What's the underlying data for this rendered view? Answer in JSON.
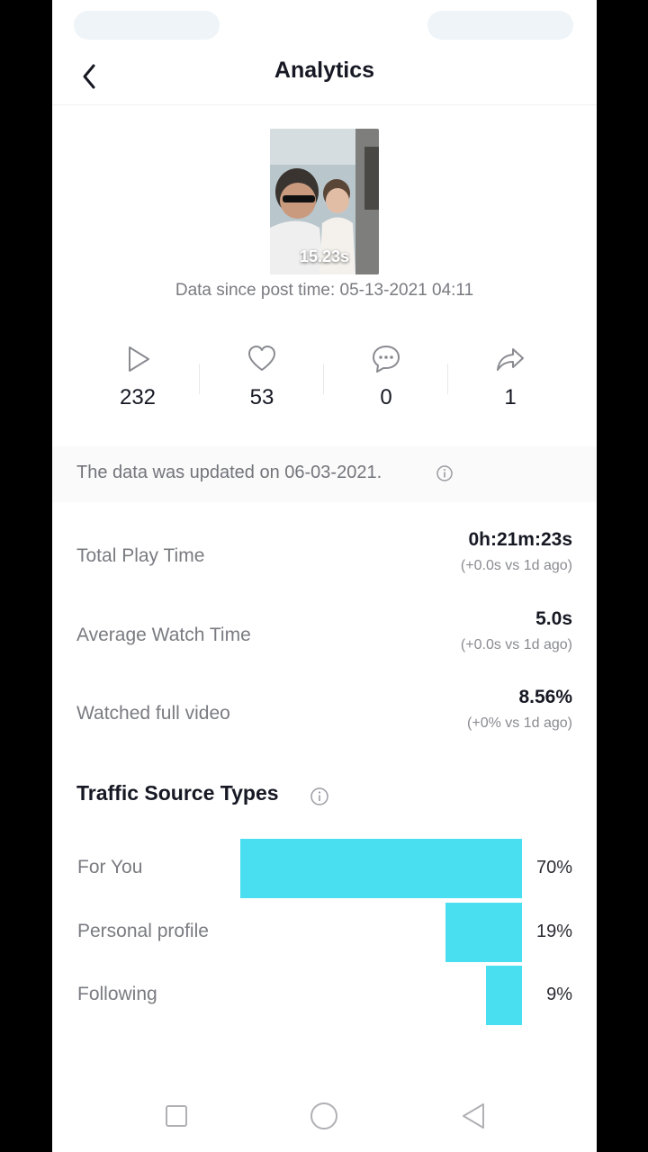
{
  "header": {
    "title": "Analytics"
  },
  "video": {
    "duration": "15.23s",
    "since_text": "Data since post time: 05-13-2021 04:11"
  },
  "stats": [
    {
      "icon": "play-icon",
      "value": "232"
    },
    {
      "icon": "heart-icon",
      "value": "53"
    },
    {
      "icon": "comment-icon",
      "value": "0"
    },
    {
      "icon": "share-icon",
      "value": "1"
    }
  ],
  "notice": {
    "text": "The data was updated on 06-03-2021."
  },
  "metrics": [
    {
      "label": "Total Play Time",
      "value": "0h:21m:23s",
      "delta": "(+0.0s vs 1d ago)"
    },
    {
      "label": "Average Watch Time",
      "value": "5.0s",
      "delta": "(+0.0s vs 1d ago)"
    },
    {
      "label": "Watched full video",
      "value": "8.56%",
      "delta": "(+0% vs 1d ago)"
    }
  ],
  "traffic": {
    "title": "Traffic Source Types",
    "bar_color": "#49dff1",
    "rows": [
      {
        "label": "For You",
        "pct_text": "70%",
        "value": 70
      },
      {
        "label": "Personal profile",
        "pct_text": "19%",
        "value": 19
      },
      {
        "label": "Following",
        "pct_text": "9%",
        "value": 9
      }
    ]
  },
  "chart_data": {
    "type": "bar",
    "categories": [
      "For You",
      "Personal profile",
      "Following"
    ],
    "values": [
      70,
      19,
      9
    ],
    "title": "Traffic Source Types"
  },
  "navbar": {
    "buttons": [
      "square-icon",
      "circle-icon",
      "triangle-back-icon"
    ]
  }
}
